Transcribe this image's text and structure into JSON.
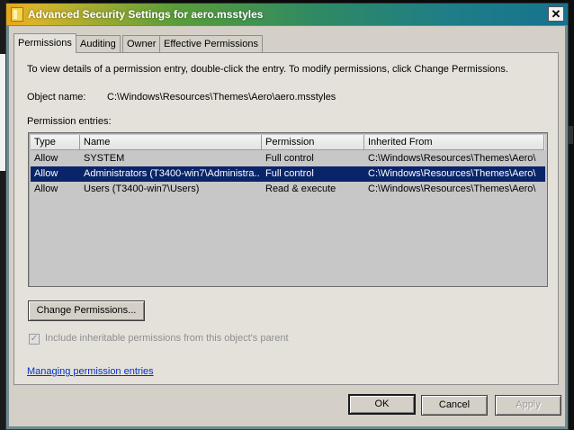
{
  "window": {
    "title": "Advanced Security Settings for aero.msstyles",
    "close_glyph": "✕"
  },
  "tabs": [
    {
      "label": "Permissions",
      "active": true
    },
    {
      "label": "Auditing",
      "active": false
    },
    {
      "label": "Owner",
      "active": false
    },
    {
      "label": "Effective Permissions",
      "active": false
    }
  ],
  "panel": {
    "intro": "To view details of a permission entry, double-click the entry. To modify permissions, click Change Permissions.",
    "object_name_label": "Object name:",
    "object_name_value": "C:\\Windows\\Resources\\Themes\\Aero\\aero.msstyles",
    "permission_entries_label": "Permission entries:"
  },
  "table": {
    "columns": [
      "Type",
      "Name",
      "Permission",
      "Inherited From"
    ],
    "rows": [
      {
        "type": "Allow",
        "name": "SYSTEM",
        "permission": "Full control",
        "inherited": "C:\\Windows\\Resources\\Themes\\Aero\\",
        "selected": false
      },
      {
        "type": "Allow",
        "name": "Administrators (T3400-win7\\Administra...",
        "permission": "Full control",
        "inherited": "C:\\Windows\\Resources\\Themes\\Aero\\",
        "selected": true
      },
      {
        "type": "Allow",
        "name": "Users (T3400-win7\\Users)",
        "permission": "Read & execute",
        "inherited": "C:\\Windows\\Resources\\Themes\\Aero\\",
        "selected": false
      }
    ]
  },
  "change_permissions_button": "Change Permissions...",
  "inherit_checkbox": {
    "label": "Include inheritable permissions from this object's parent",
    "checked": true,
    "enabled": false,
    "glyph": "✓"
  },
  "help_link": "Managing permission entries",
  "footer": {
    "ok": "OK",
    "cancel": "Cancel",
    "apply": "Apply"
  },
  "colors": {
    "selection": "#0a246a",
    "dialog_face": "#d4d0c8",
    "link": "#0033cc"
  }
}
